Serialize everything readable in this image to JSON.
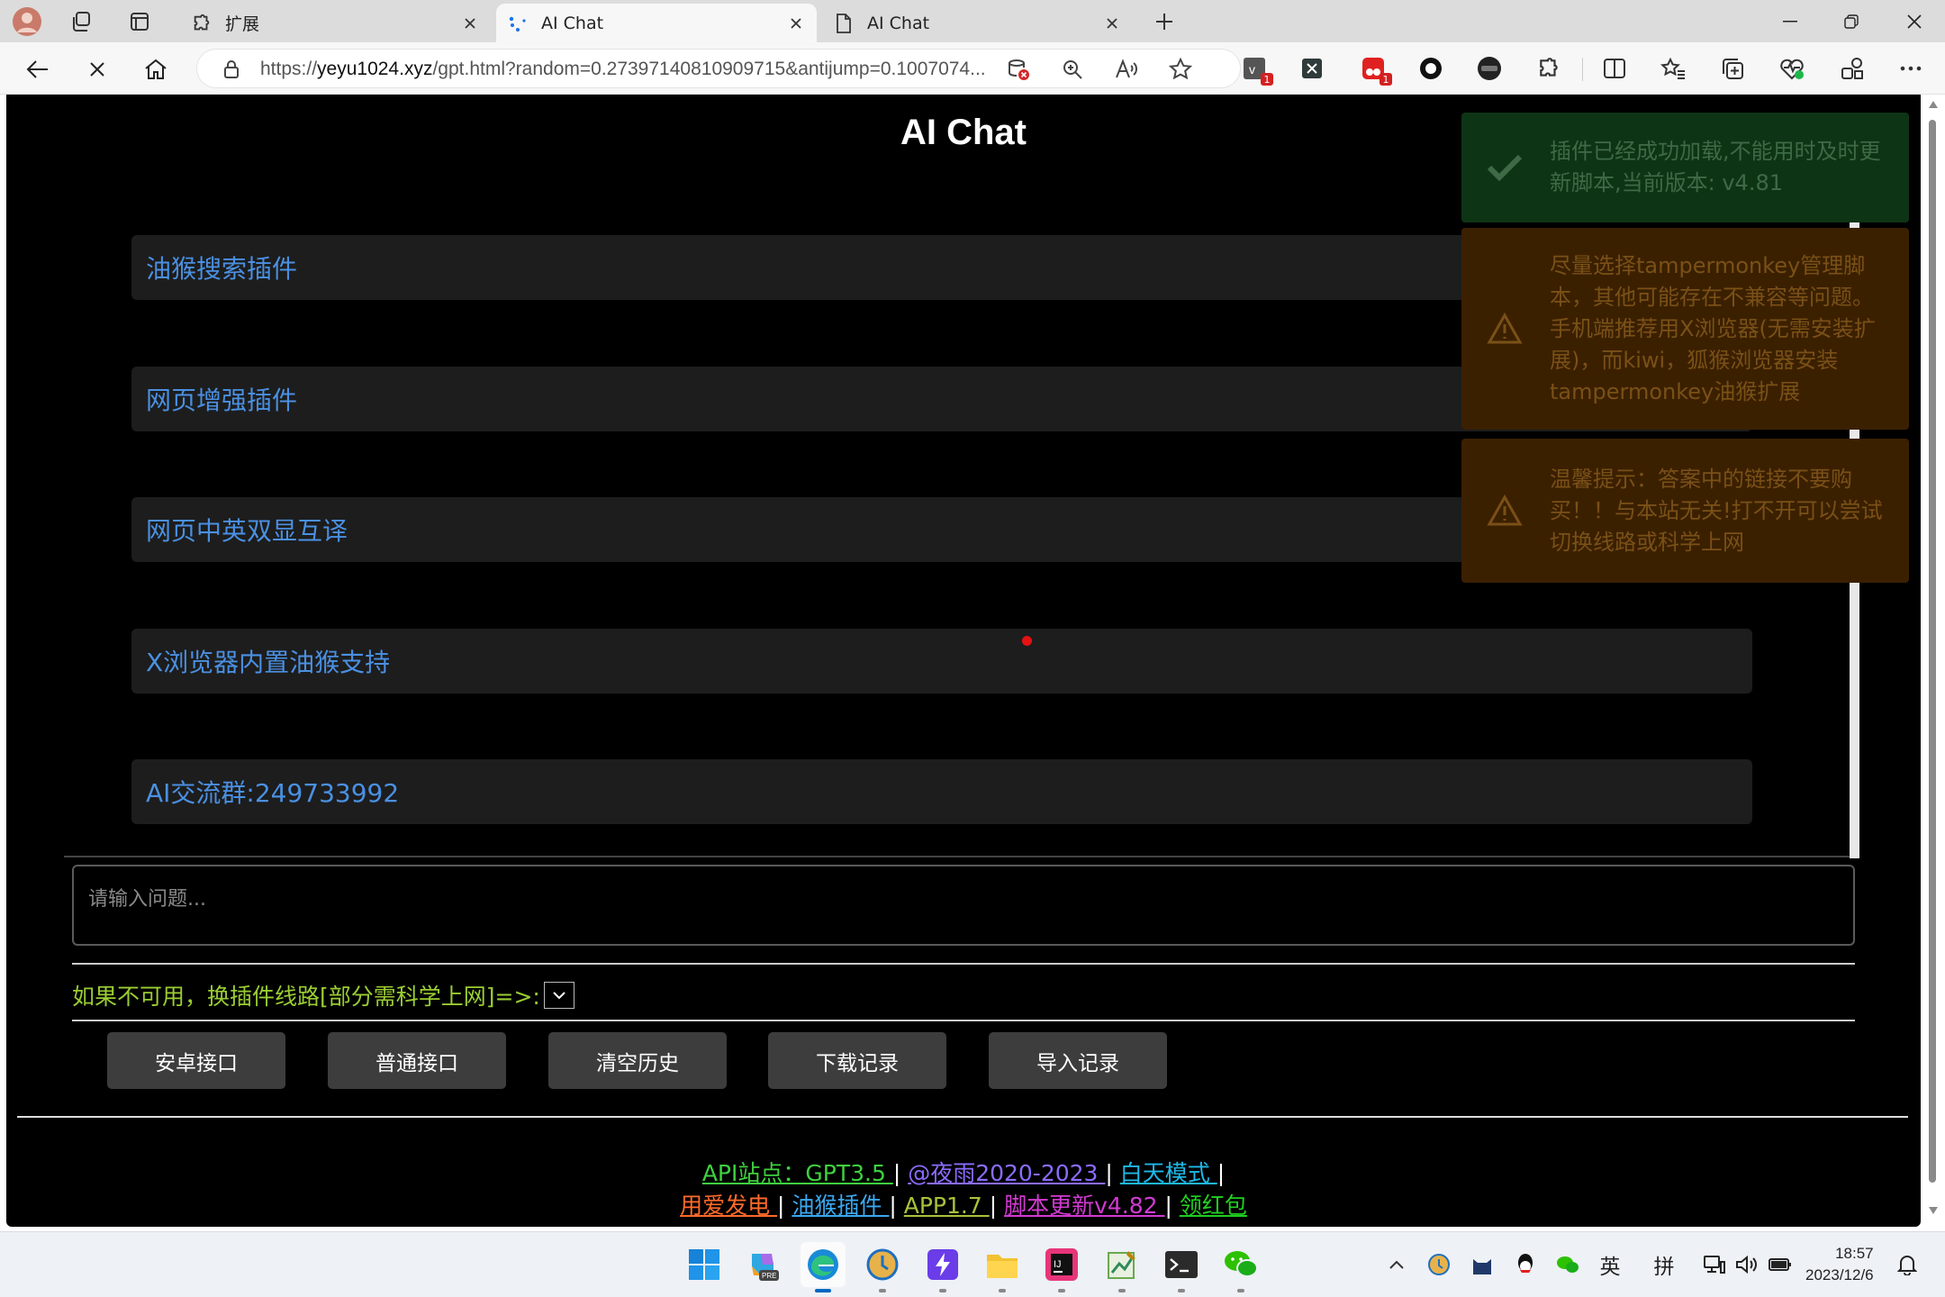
{
  "browser": {
    "tabs": [
      {
        "label": "扩展",
        "icon": "puzzle-icon"
      },
      {
        "label": "AI Chat",
        "icon": "loading-icon",
        "active": true
      },
      {
        "label": "AI Chat",
        "icon": "page-icon"
      }
    ],
    "address": {
      "url_prefix": "https://",
      "url_host": "yeyu1024.xyz",
      "url_rest": "/gpt.html?random=0.27397140810909715&antijump=0.1007074..."
    }
  },
  "page": {
    "title": "AI Chat",
    "link_cards": [
      {
        "label": "油猴搜索插件"
      },
      {
        "label": "网页增强插件"
      },
      {
        "label": "网页中英双显互译"
      },
      {
        "label": "X浏览器内置油猴支持"
      },
      {
        "label": "AI交流群:249733992"
      }
    ],
    "prompt_placeholder": "请输入问题...",
    "route_label": "如果不可用，换插件线路[部分需科学上网]=>:",
    "buttons": [
      {
        "label": "安卓接口"
      },
      {
        "label": "普通接口"
      },
      {
        "label": "清空历史"
      },
      {
        "label": "下载记录"
      },
      {
        "label": "导入记录"
      }
    ],
    "footer": {
      "api": "API站点：GPT3.5 ",
      "author": "@夜雨2020-2023 ",
      "day_mode": "白天模式 ",
      "donate": "用爱发电 ",
      "plugin": "油猴插件 ",
      "app": "APP1.7 ",
      "update": "脚本更新v4.82 ",
      "redpack": "领红包",
      "sep": " | "
    },
    "colors": {
      "link_blue": "#4a90e2",
      "route_green": "#9acd32",
      "footer_green": "#3fd13f",
      "footer_purple": "#8a6cff",
      "footer_cyan": "#1fb8e8",
      "footer_orange": "#ff6a2a",
      "footer_sky": "#3aa8f0",
      "footer_olive": "#a8c23a",
      "footer_magenta": "#d23ad2",
      "footer_lime": "#20d020"
    }
  },
  "toasts": [
    {
      "type": "success",
      "icon": "check-icon",
      "text": "插件已经成功加载,不能用时及时更新脚本,当前版本: v4.81"
    },
    {
      "type": "warning",
      "icon": "warning-icon",
      "text": "尽量选择tampermonkey管理脚本，其他可能存在不兼容等问题。手机端推荐用X浏览器(无需安装扩展)，而kiwi，狐猴浏览器安装tampermonkey油猴扩展"
    },
    {
      "type": "warning",
      "icon": "warning-icon",
      "text": "温馨提示：答案中的链接不要购买！！与本站无关!打不开可以尝试切换线路或科学上网"
    }
  ],
  "taskbar": {
    "tray_lang1": "英",
    "tray_lang2": "拼",
    "time": "18:57",
    "date": "2023/12/6"
  }
}
